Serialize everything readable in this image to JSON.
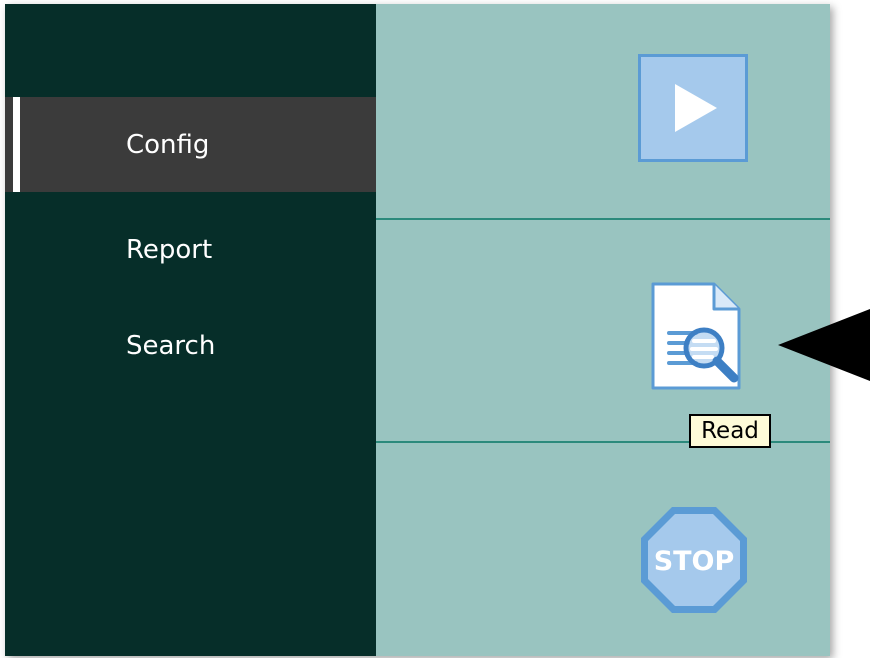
{
  "sidebar": {
    "items": [
      {
        "label": "Config",
        "active": true,
        "icon": ""
      },
      {
        "label": "Report",
        "active": false,
        "icon": ""
      },
      {
        "label": "Search",
        "active": false,
        "icon": ""
      }
    ]
  },
  "toolbar": {
    "buttons": [
      {
        "name": "play",
        "icon": "play-icon"
      },
      {
        "name": "read",
        "icon": "document-search-icon"
      },
      {
        "name": "stop",
        "icon": "stop-sign-icon",
        "text": "STOP"
      }
    ]
  },
  "tooltip": {
    "text": "Read"
  },
  "colors": {
    "sidebar_bg": "#062e29",
    "sidebar_active_bg": "#3b3b3b",
    "panel_bg": "#99c4c0",
    "divider": "#2c8a7c",
    "icon_fill": "#a5c9ec",
    "icon_stroke": "#5b9bd5",
    "tooltip_bg": "#fefbd8"
  }
}
